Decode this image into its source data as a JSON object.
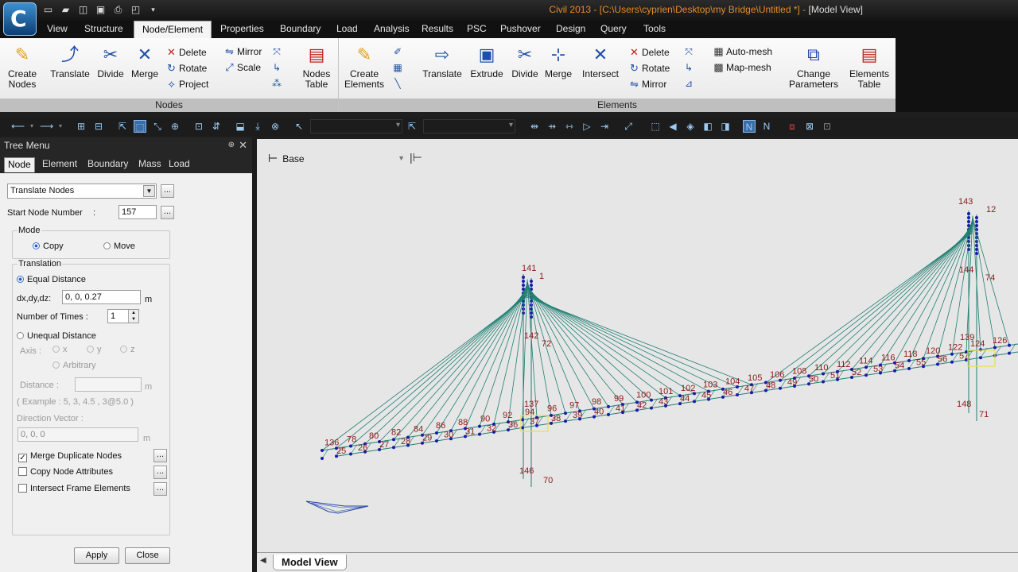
{
  "app": {
    "logo_letter": "C",
    "logo_sub": "C",
    "title": "Civil 2013 - [C:\\Users\\cyprien\\Desktop\\my Bridge\\Untitled *] - ",
    "title_view": "[Model View]",
    "qat_icons": [
      "new-file-icon",
      "open-folder-icon",
      "open-icon",
      "save-icon",
      "print-icon",
      "print-preview-icon",
      "qat-dropdown-icon"
    ]
  },
  "menu": {
    "tabs": [
      "View",
      "Structure",
      "Node/Element",
      "Properties",
      "Boundary",
      "Load",
      "Analysis",
      "Results",
      "PSC",
      "Pushover",
      "Design",
      "Query",
      "Tools"
    ],
    "active": "Node/Element"
  },
  "ribbon": {
    "nodes_group": "Nodes",
    "elements_group": "Elements",
    "create_nodes": "Create\nNodes",
    "translate": "Translate",
    "divide": "Divide",
    "merge": "Merge",
    "delete": "Delete",
    "rotate": "Rotate",
    "project": "Project",
    "mirror": "Mirror",
    "scale": "Scale",
    "nodes_table": "Nodes\nTable",
    "create_elements": "Create\nElements",
    "el_translate": "Translate",
    "el_extrude": "Extrude",
    "el_divide": "Divide",
    "el_merge": "Merge",
    "el_intersect": "Intersect",
    "el_delete": "Delete",
    "el_rotate": "Rotate",
    "el_mirror": "Mirror",
    "auto_mesh": "Auto-mesh",
    "map_mesh": "Map-mesh",
    "change_parameters": "Change\nParameters",
    "elements_table": "Elements\nTable"
  },
  "tree_menu": {
    "title": "Tree Menu",
    "tabs": [
      "Node",
      "Element",
      "Boundary",
      "Mass",
      "Load"
    ],
    "active_tab": "Node",
    "function": "Translate Nodes",
    "start_node_label": "Start Node Number",
    "start_node_colon": ":",
    "start_node_value": "157",
    "mode_label": "Mode",
    "mode_copy": "Copy",
    "mode_move": "Move",
    "translation_label": "Translation",
    "equal_distance": "Equal Distance",
    "dxdydz_label": "dx,dy,dz:",
    "dxdydz_value": "0, 0, 0.27",
    "unit_m": "m",
    "num_times_label": "Number of Times :",
    "num_times_value": "1",
    "unequal_distance": "Unequal Distance",
    "axis_label": "Axis :",
    "axis_x": "x",
    "axis_y": "y",
    "axis_z": "z",
    "axis_arbitrary": "Arbitrary",
    "distance_label": "Distance   :",
    "distance_value": "",
    "example_text": "( Example :  5, 3, 4.5 , 3@5.0 )",
    "direction_vector_label": "Direction Vector :",
    "direction_vector_value": "0, 0, 0",
    "merge_duplicate": "Merge Duplicate Nodes",
    "merge_duplicate_checked": true,
    "copy_node_attributes": "Copy Node Attributes",
    "intersect_frame": "Intersect Frame Elements",
    "apply": "Apply",
    "close": "Close",
    "dots": "..."
  },
  "model_view": {
    "base_combo": "Base",
    "tab": "Model View"
  },
  "chart_data": {
    "type": "scatter",
    "note": "",
    "deck_node_labels_left_span": [
      "136",
      "78",
      "80",
      "82",
      "84",
      "86",
      "88",
      "90",
      "92",
      "94"
    ],
    "deck_node_labels_center_span": [
      "96",
      "97",
      "98",
      "99",
      "100",
      "101",
      "102",
      "103",
      "104",
      "105",
      "106",
      "108",
      "110",
      "112",
      "114",
      "116",
      "118",
      "120",
      "122",
      "124",
      "126"
    ],
    "deck_elem_labels": [
      "25",
      "26",
      "27",
      "28",
      "29",
      "30",
      "31",
      "32",
      "36",
      "37",
      "38",
      "39",
      "40",
      "41",
      "42",
      "43",
      "44",
      "45",
      "46",
      "47",
      "48",
      "49",
      "50",
      "51",
      "52",
      "53",
      "54",
      "55",
      "56",
      "57"
    ],
    "pylon_left_labels": [
      "141",
      "142",
      "137",
      "146",
      "70",
      "72",
      "1"
    ],
    "pylon_right_labels": [
      "143",
      "144",
      "139",
      "148",
      "71",
      "74",
      "12"
    ],
    "colors": {
      "cable": "#1f7f72",
      "node": "#1a1aa8",
      "label": "#8b1a1a",
      "background": "#e6e6e6"
    }
  }
}
